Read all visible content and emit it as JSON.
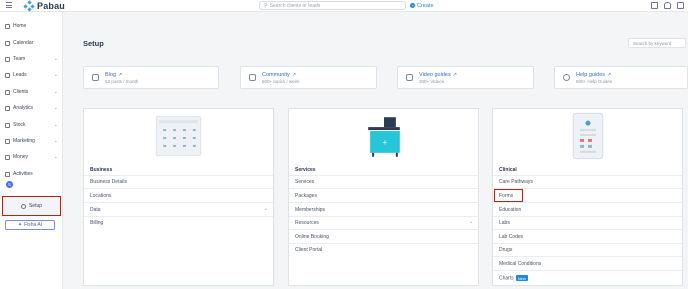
{
  "app": {
    "logo_text": "Pabau"
  },
  "topbar": {
    "search_placeholder": "Search clients or leads",
    "create_label": "Create"
  },
  "sidebar": {
    "items": [
      {
        "label": "Home"
      },
      {
        "label": "Calendar"
      },
      {
        "label": "Team"
      },
      {
        "label": "Leads"
      },
      {
        "label": "Clients"
      },
      {
        "label": "Analytics"
      },
      {
        "label": "Stock"
      },
      {
        "label": "Marketing"
      },
      {
        "label": "Money"
      },
      {
        "label": "Activities"
      }
    ],
    "activities_badge": "5",
    "setup_label": "Setup",
    "fisha_label": "Fisha AI"
  },
  "main": {
    "title": "Setup",
    "keyword_placeholder": "Search by keyword",
    "resources": [
      {
        "title": "Blog",
        "subtitle": "53 posts / month"
      },
      {
        "title": "Community",
        "subtitle": "500+ topics / week"
      },
      {
        "title": "Video guides",
        "subtitle": "300+ Videos"
      },
      {
        "title": "Help guides",
        "subtitle": "500+ Help Guides"
      }
    ],
    "panels": [
      {
        "heading": "Business",
        "rows": [
          "Business Details",
          "Locations",
          "Data",
          "Billing"
        ]
      },
      {
        "heading": "Services",
        "rows": [
          "Services",
          "Packages",
          "Memberships",
          "Resources",
          "Online Booking",
          "Client Portal"
        ]
      },
      {
        "heading": "Clinical",
        "rows": [
          "Care Pathways",
          "Forms",
          "Education",
          "Labs",
          "Lab Codes",
          "Drugs",
          "Medical Conditions",
          "Charts"
        ],
        "new_badge": "New"
      }
    ]
  },
  "colors": {
    "accent": "#1e88e5",
    "highlight_box": "#b0271c",
    "brand": "#3aa3d8"
  }
}
